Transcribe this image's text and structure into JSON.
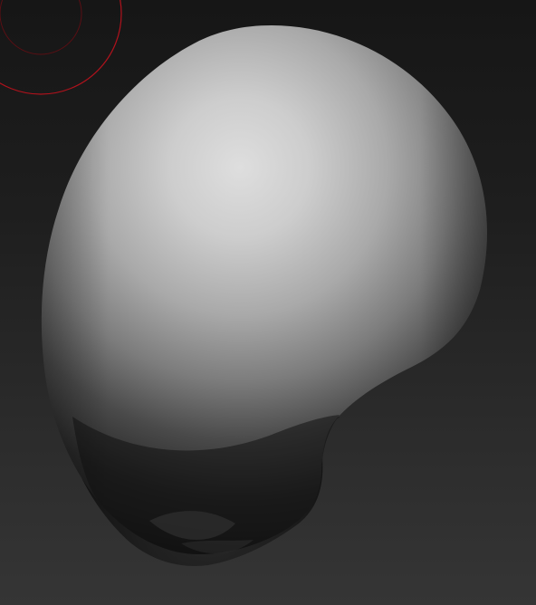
{
  "viewport": {
    "background_top": "#161616",
    "background_bottom": "#353535"
  },
  "brush_cursor": {
    "icon": "brush-radius-circle",
    "color": "#b0121c"
  },
  "mesh": {
    "shading": "matcap-clay",
    "highlight_color": "#dcdcdc",
    "mid_color": "#8c8c8c",
    "shadow_color": "#151515"
  }
}
